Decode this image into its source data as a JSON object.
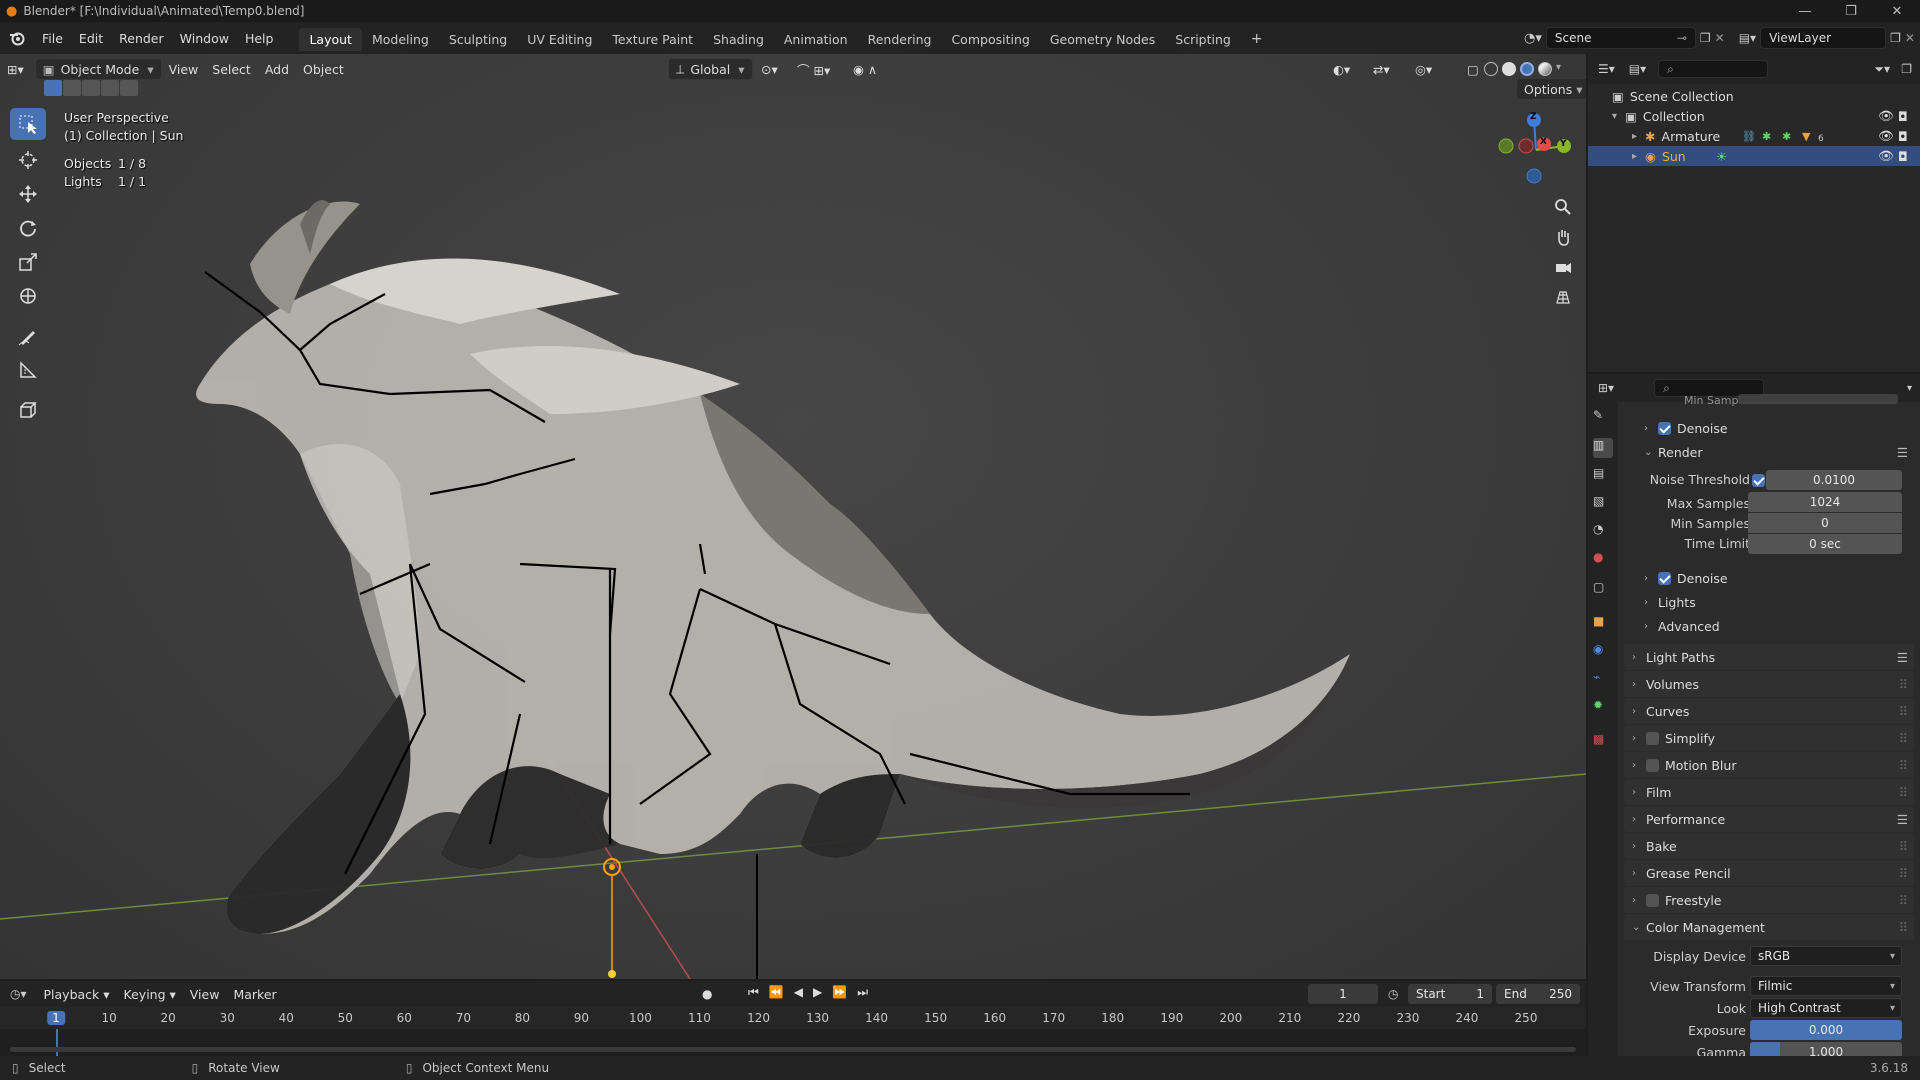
{
  "window": {
    "title": "Blender* [F:\\Individual\\Animated\\Temp0.blend]",
    "minimize_icon": "minimize-icon",
    "maximize_icon": "restore-icon",
    "close_icon": "close-icon"
  },
  "menubar": {
    "menus": [
      "File",
      "Edit",
      "Render",
      "Window",
      "Help"
    ],
    "workspaces": [
      "Layout",
      "Modeling",
      "Sculpting",
      "UV Editing",
      "Texture Paint",
      "Shading",
      "Animation",
      "Rendering",
      "Compositing",
      "Geometry Nodes",
      "Scripting"
    ],
    "active_workspace": "Layout",
    "scene_label": "Scene",
    "viewlayer_label": "ViewLayer"
  },
  "viewport": {
    "mode": "Object Mode",
    "menus": [
      "View",
      "Select",
      "Add",
      "Object"
    ],
    "transform_orientation": "Global",
    "options_label": "Options",
    "overlay": {
      "view_name": "User Perspective",
      "collection_info": "(1) Collection | Sun",
      "objects_label": "Objects",
      "objects_value": "1 / 8",
      "lights_label": "Lights",
      "lights_value": "1 / 1"
    },
    "gizmo_axes": [
      "Z",
      "X",
      "Y"
    ],
    "tools": [
      "select-box-icon",
      "cursor-icon",
      "move-icon",
      "rotate-icon",
      "scale-icon",
      "transform-icon",
      "annotate-icon",
      "measure-icon",
      "add-cube-icon"
    ]
  },
  "outliner": {
    "root": "Scene Collection",
    "collection": "Collection",
    "items": [
      {
        "name": "Armature",
        "icon": "armature-icon",
        "selected": false
      },
      {
        "name": "Sun",
        "icon": "light-icon",
        "selected": true
      }
    ],
    "armature_modifier_count": "6"
  },
  "properties": {
    "truncated_row": "Min Samples",
    "viewport_denoise_label": "Denoise",
    "render_subpanel": "Render",
    "noise_threshold_label": "Noise Threshold",
    "noise_threshold_value": "0.0100",
    "max_samples_label": "Max Samples",
    "max_samples_value": "1024",
    "min_samples_label": "Min Samples",
    "min_samples_value": "0",
    "time_limit_label": "Time Limit",
    "time_limit_value": "0 sec",
    "render_denoise_label": "Denoise",
    "lights_label": "Lights",
    "advanced_label": "Advanced",
    "panels": [
      {
        "label": "Light Paths",
        "checkbox": false,
        "list_icon": true
      },
      {
        "label": "Volumes",
        "checkbox": false,
        "list_icon": false
      },
      {
        "label": "Curves",
        "checkbox": false,
        "list_icon": false
      },
      {
        "label": "Simplify",
        "checkbox": true,
        "list_icon": false
      },
      {
        "label": "Motion Blur",
        "checkbox": true,
        "list_icon": false
      },
      {
        "label": "Film",
        "checkbox": false,
        "list_icon": false
      },
      {
        "label": "Performance",
        "checkbox": false,
        "list_icon": true
      },
      {
        "label": "Bake",
        "checkbox": false,
        "list_icon": false
      },
      {
        "label": "Grease Pencil",
        "checkbox": false,
        "list_icon": false
      },
      {
        "label": "Freestyle",
        "checkbox": true,
        "list_icon": false
      }
    ],
    "color_management_label": "Color Management",
    "display_device_label": "Display Device",
    "display_device_value": "sRGB",
    "view_transform_label": "View Transform",
    "view_transform_value": "Filmic",
    "look_label": "Look",
    "look_value": "High Contrast",
    "exposure_label": "Exposure",
    "exposure_value": "0.000",
    "gamma_label": "Gamma",
    "gamma_value": "1.000",
    "gamma_fill": 0.2,
    "version": "3.6.18"
  },
  "timeline": {
    "menus": [
      "Playback",
      "Keying",
      "View",
      "Marker"
    ],
    "current_frame": "1",
    "start_label": "Start",
    "start_value": "1",
    "end_label": "End",
    "end_value": "250",
    "ticks": [
      "1",
      "10",
      "20",
      "30",
      "40",
      "50",
      "60",
      "70",
      "80",
      "90",
      "100",
      "110",
      "120",
      "130",
      "140",
      "150",
      "160",
      "170",
      "180",
      "190",
      "200",
      "210",
      "220",
      "230",
      "240",
      "250"
    ]
  },
  "statusbar": {
    "select": "Select",
    "rotate_view": "Rotate View",
    "context_menu": "Object Context Menu"
  },
  "colors": {
    "accent": "#4772b3",
    "selection_orange": "#ffa500",
    "axis_x": "#e14b4b",
    "axis_y": "#8ab42a",
    "axis_z": "#3d7ed8"
  }
}
